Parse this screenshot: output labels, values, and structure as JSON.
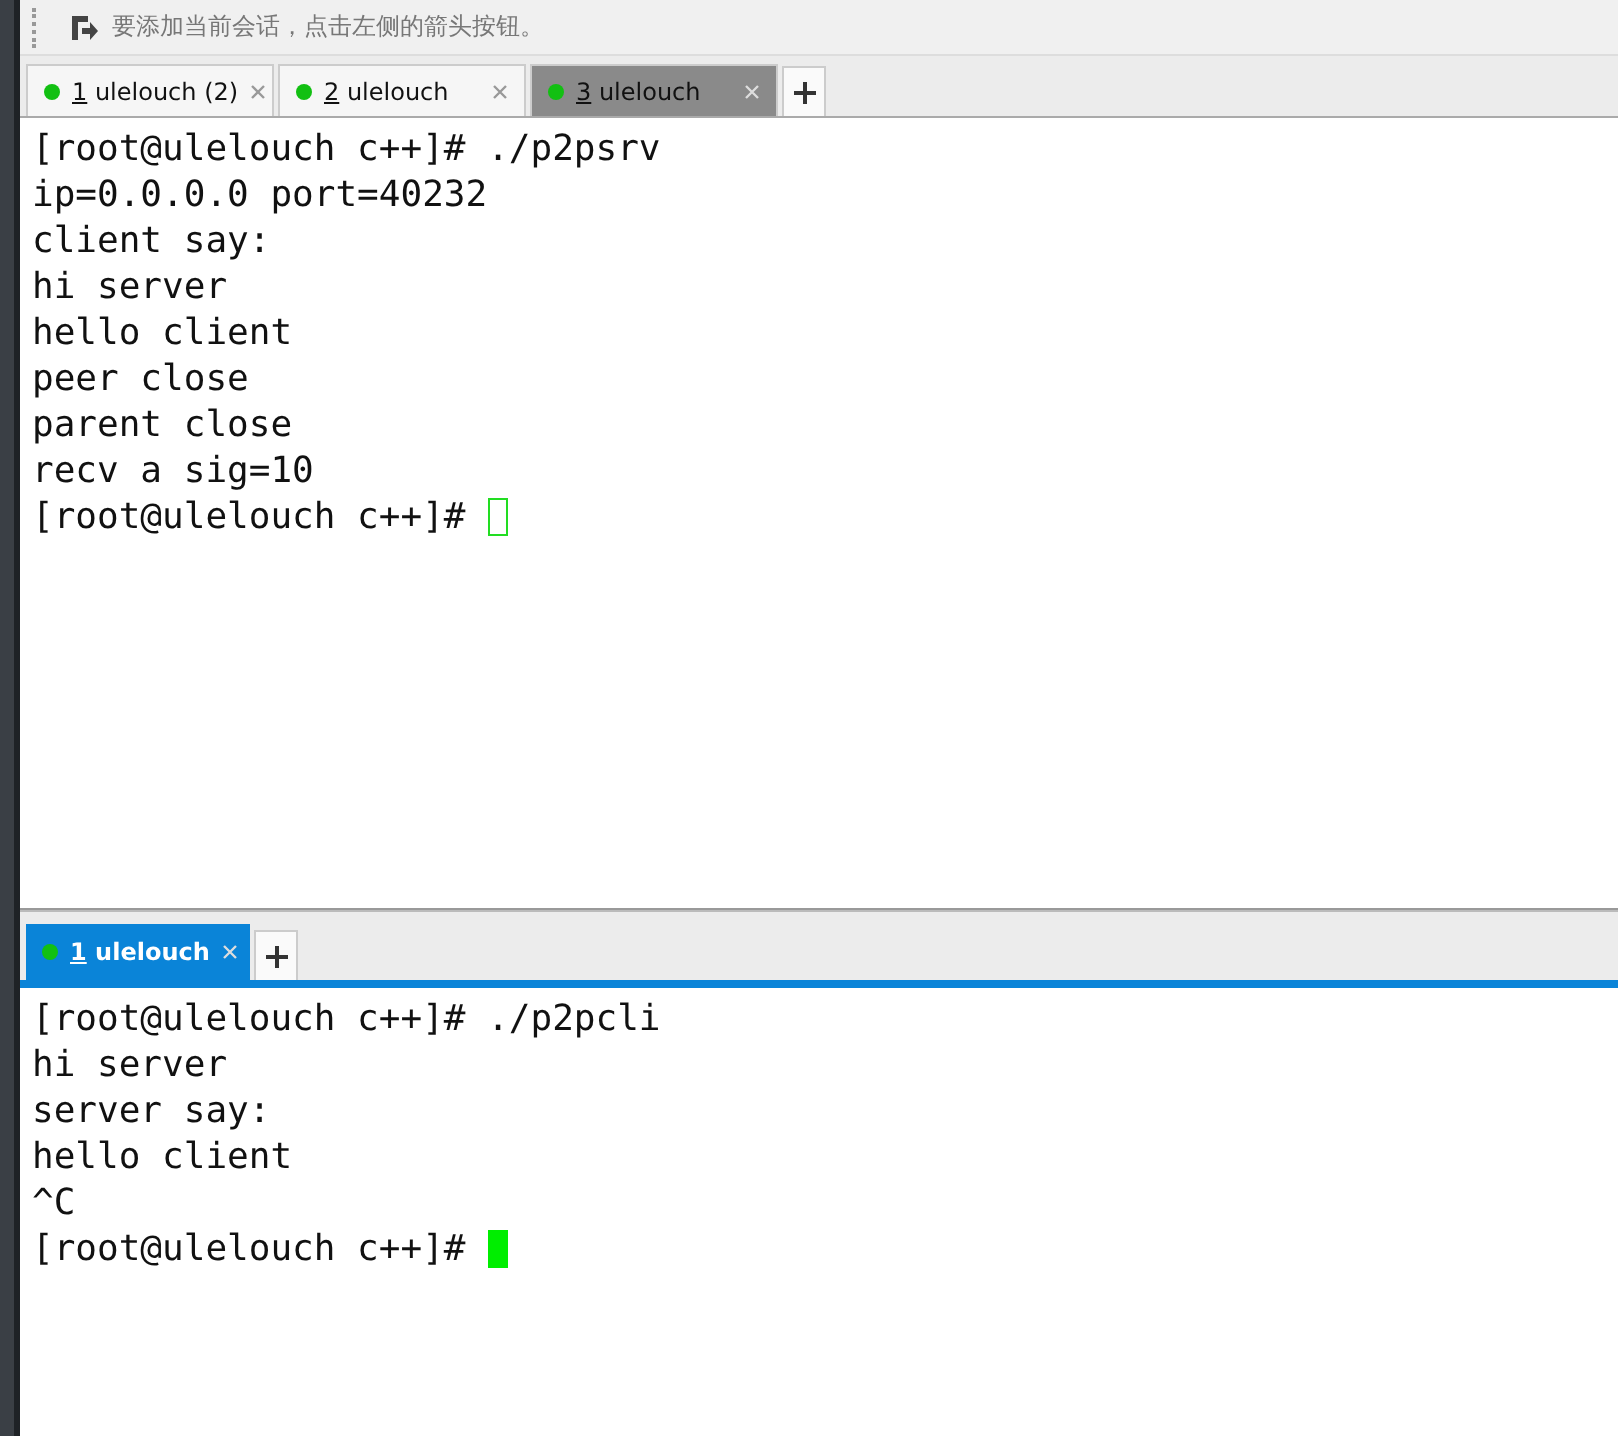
{
  "toolbar": {
    "hint": "要添加当前会话，点击左侧的箭头按钮。"
  },
  "panes": [
    {
      "tabs": [
        {
          "number": "1",
          "label": "ulelouch (2)",
          "selected": false
        },
        {
          "number": "2",
          "label": "ulelouch",
          "selected": false
        },
        {
          "number": "3",
          "label": "ulelouch",
          "selected": true
        }
      ],
      "lines": [
        "[root@ulelouch c++]# ./p2psrv",
        "ip=0.0.0.0 port=40232",
        "client say:",
        "hi server",
        "hello client",
        "peer close",
        "parent close",
        "recv a sig=10",
        "[root@ulelouch c++]# "
      ],
      "focused": false
    },
    {
      "tabs": [
        {
          "number": "1",
          "label": "ulelouch",
          "selected": true
        }
      ],
      "lines": [
        "[root@ulelouch c++]# ./p2pcli",
        "hi server",
        "server say:",
        "hello client",
        "^C",
        "[root@ulelouch c++]# "
      ],
      "focused": true
    }
  ]
}
